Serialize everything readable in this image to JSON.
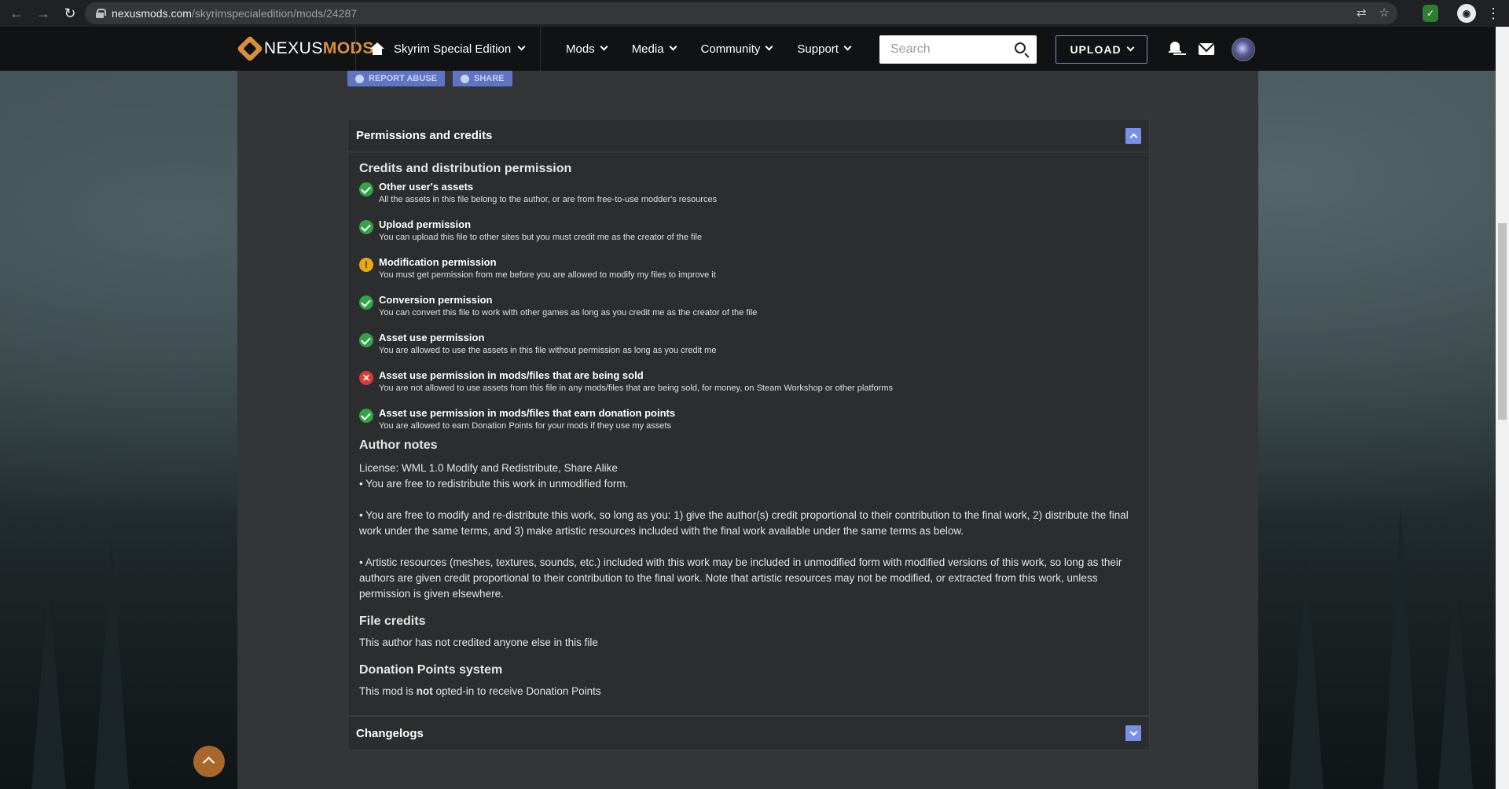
{
  "browser": {
    "url_host": "nexusmods.com",
    "url_path": "/skyrimspecialedition/mods/24287"
  },
  "header": {
    "logo_prefix": "NEXUS",
    "logo_suffix": "MODS",
    "game": "Skyrim Special Edition",
    "nav": [
      "Mods",
      "Media",
      "Community",
      "Support"
    ],
    "search_placeholder": "Search",
    "upload_label": "UPLOAD"
  },
  "top_buttons": {
    "report": "REPORT ABUSE",
    "share": "SHARE"
  },
  "permissions": {
    "box_title": "Permissions and credits",
    "section_title": "Credits and distribution permission",
    "items": [
      {
        "status": "ok",
        "title": "Other user's assets",
        "desc": "All the assets in this file belong to the author, or are from free-to-use modder's resources"
      },
      {
        "status": "ok",
        "title": "Upload permission",
        "desc": "You can upload this file to other sites but you must credit me as the creator of the file"
      },
      {
        "status": "warn",
        "title": "Modification permission",
        "desc": "You must get permission from me before you are allowed to modify my files to improve it"
      },
      {
        "status": "ok",
        "title": "Conversion permission",
        "desc": "You can convert this file to work with other games as long as you credit me as the creator of the file"
      },
      {
        "status": "ok",
        "title": "Asset use permission",
        "desc": "You are allowed to use the assets in this file without permission as long as you credit me"
      },
      {
        "status": "no",
        "title": "Asset use permission in mods/files that are being sold",
        "desc": "You are not allowed to use assets from this file in any mods/files that are being sold, for money, on Steam Workshop or other platforms"
      },
      {
        "status": "ok",
        "title": "Asset use permission in mods/files that earn donation points",
        "desc": "You are allowed to earn Donation Points for your mods if they use my assets"
      }
    ],
    "author_notes_title": "Author notes",
    "author_notes": [
      "License: WML 1.0 Modify and Redistribute, Share Alike",
      "• You are free to redistribute this work in unmodified form.",
      "• You are free to modify and re-distribute this work, so long as you: 1) give the author(s) credit proportional to their contribution to the final work, 2) distribute the final work under the same terms, and 3) make artistic resources included with the final work available under the same terms as below.",
      "• Artistic resources (meshes, textures, sounds, etc.) included with this work may be included in unmodified form with modified versions of this work, so long as their authors are given credit proportional to their contribution to the final work. Note that artistic resources may not be modified, or extracted from this work, unless permission is given elsewhere."
    ],
    "file_credits_title": "File credits",
    "file_credits_text": "This author has not credited anyone else in this file",
    "donation_title": "Donation Points system",
    "donation_pre": "This mod is ",
    "donation_bold": "not",
    "donation_post": " opted-in to receive Donation Points"
  },
  "changelogs": {
    "title": "Changelogs"
  },
  "colors": {
    "accent": "#7a8fe8",
    "ok": "#35a24a",
    "warn": "#e8a713",
    "no": "#d93a3a",
    "brand": "#d98f40"
  }
}
